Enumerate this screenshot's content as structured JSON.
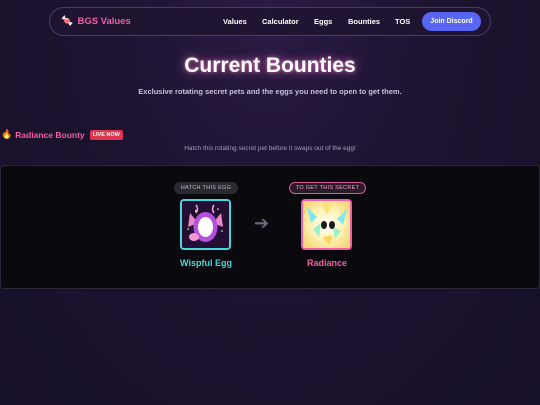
{
  "brand": {
    "icon": "candy-icon",
    "name": "BGS Values"
  },
  "nav": {
    "links": [
      "Values",
      "Calculator",
      "Eggs",
      "Bounties",
      "TOS"
    ],
    "discord_button": "Join Discord"
  },
  "hero": {
    "title": "Current Bounties",
    "subtitle": "Exclusive rotating secret pets and the eggs you need to open to get them."
  },
  "bounty": {
    "icon": "fire-icon",
    "title": "Radiance Bounty",
    "badge": "LIVE NOW",
    "description": "Hatch this rotating secret pet before it swaps out of the egg!",
    "egg": {
      "tag": "HATCH THIS EGG",
      "name": "Wispful Egg"
    },
    "pet": {
      "tag": "TO GET THIS SECRET",
      "name": "Radiance"
    },
    "arrow_icon": "arrow-right-icon"
  },
  "colors": {
    "accent_pink": "#ee5fa6",
    "accent_cyan": "#49d6e0",
    "discord": "#5865f2",
    "live_badge": "#e0344f"
  }
}
